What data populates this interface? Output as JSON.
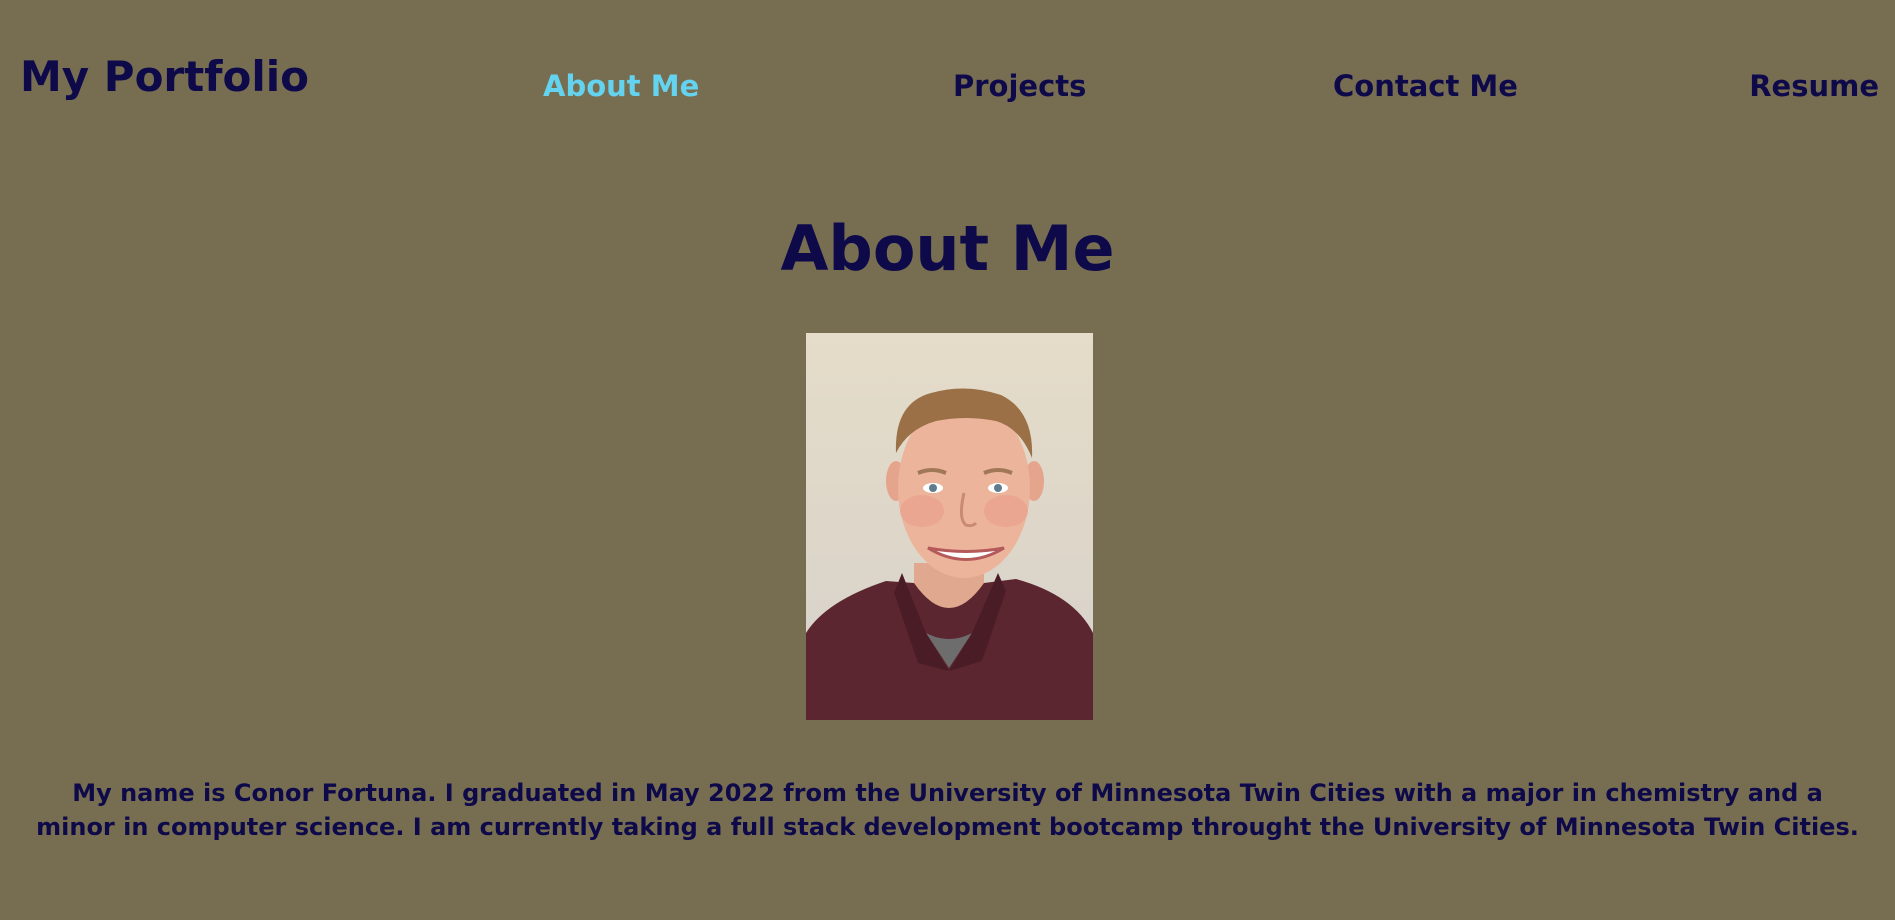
{
  "header": {
    "brand": "My Portfolio",
    "nav": [
      {
        "label": "About Me",
        "active": true
      },
      {
        "label": "Projects",
        "active": false
      },
      {
        "label": "Contact Me",
        "active": false
      },
      {
        "label": "Resume",
        "active": false
      }
    ]
  },
  "colors": {
    "background": "#776e52",
    "text": "#0e0a4a",
    "active_link": "#64d3ef"
  },
  "main": {
    "title": "About Me",
    "photo_icon": "profile-photo",
    "bio": "My name is Conor Fortuna. I graduated in May 2022 from the University of Minnesota Twin Cities with a major in chemistry and a minor in computer science. I am currently taking a full stack development bootcamp throught the University of Minnesota Twin Cities."
  }
}
